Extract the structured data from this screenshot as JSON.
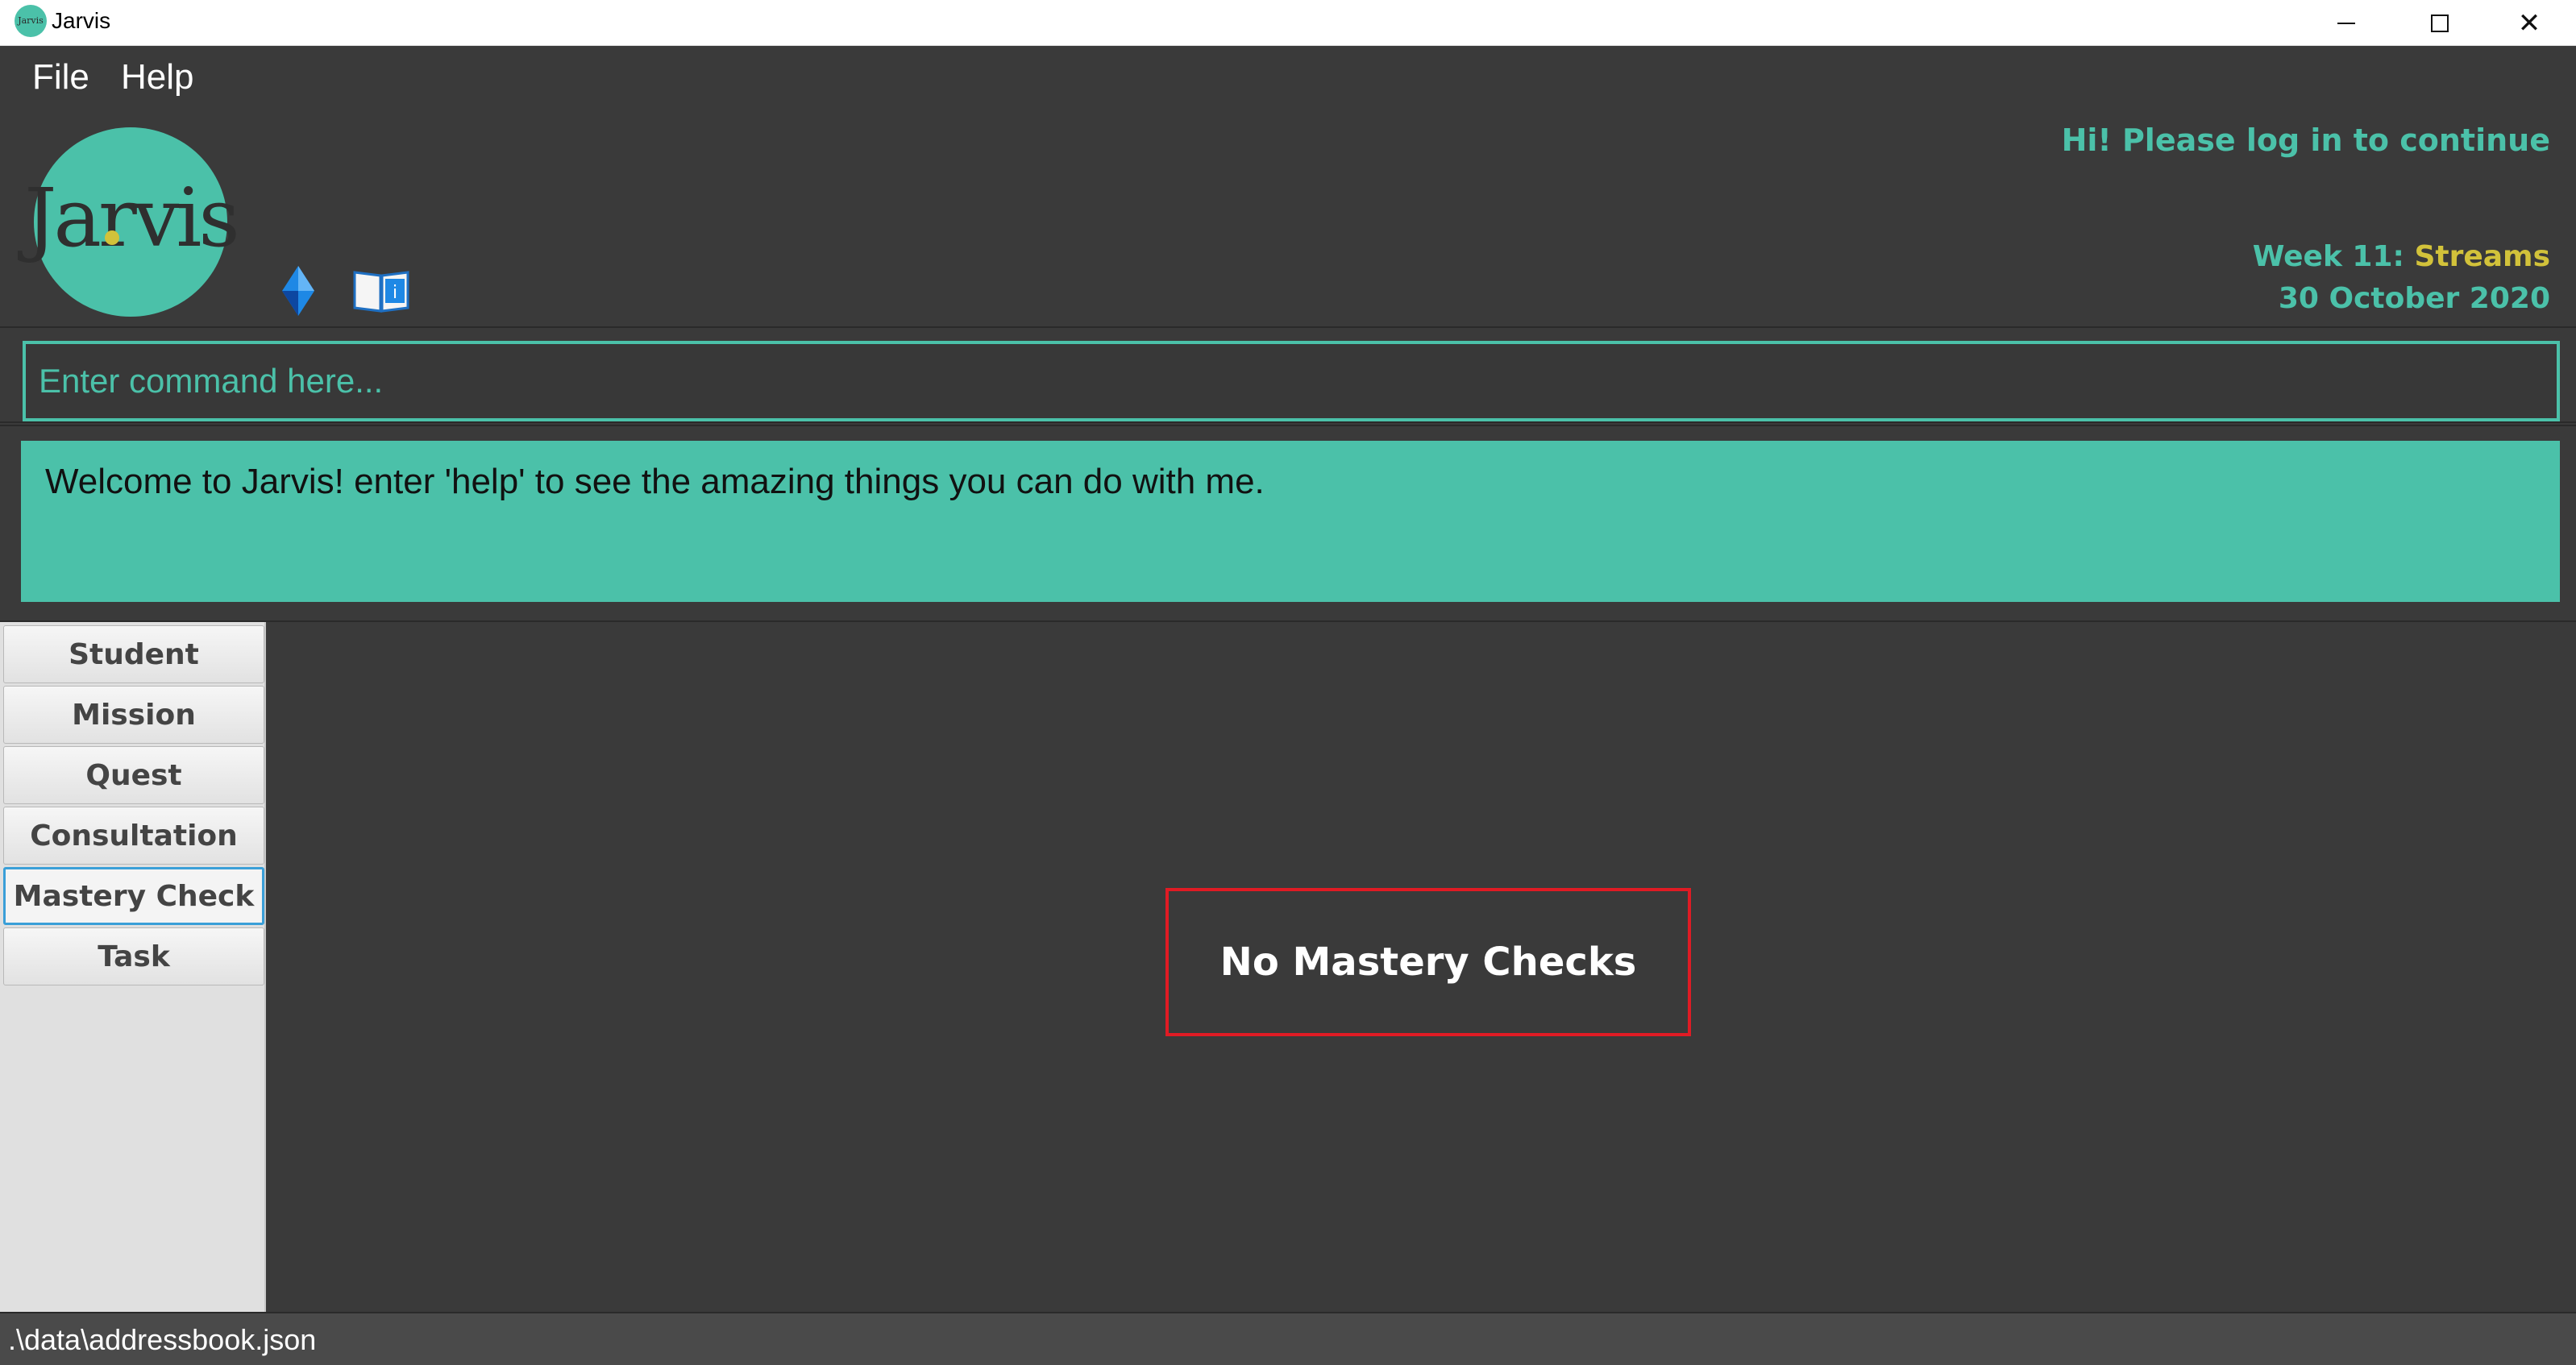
{
  "window": {
    "title": "Jarvis",
    "icon_text": "Jarvis"
  },
  "menu": {
    "items": [
      {
        "label": "File"
      },
      {
        "label": "Help"
      }
    ]
  },
  "header": {
    "logo_text": "Jarvis",
    "greeting": "Hi! Please log in to continue",
    "week_prefix": "Week 11: ",
    "week_topic": "Streams",
    "date": "30 October 2020",
    "icons": [
      "diamond-icon",
      "book-info-icon"
    ],
    "colors": {
      "accent": "#4bc1a9",
      "topic": "#d2c23a"
    }
  },
  "command": {
    "placeholder": "Enter command here...",
    "value": ""
  },
  "result": {
    "message": "Welcome to Jarvis! enter 'help' to see the amazing things you can do with me."
  },
  "sidebar": {
    "items": [
      {
        "label": "Student"
      },
      {
        "label": "Mission"
      },
      {
        "label": "Quest"
      },
      {
        "label": "Consultation"
      },
      {
        "label": "Mastery Check",
        "active": true
      },
      {
        "label": "Task"
      }
    ]
  },
  "main": {
    "empty_message": "No Mastery Checks"
  },
  "status": {
    "path": ".\\data\\addressbook.json"
  }
}
